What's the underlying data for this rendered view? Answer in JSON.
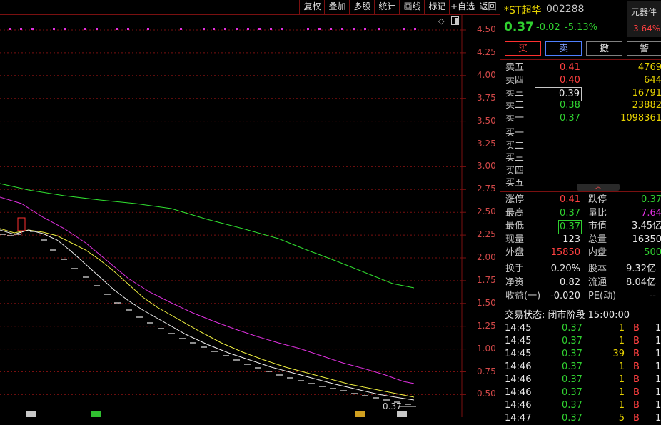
{
  "toolbar": {
    "items": [
      "复权",
      "叠加",
      "多股",
      "统计",
      "画线",
      "标记",
      "+自选",
      "返回"
    ]
  },
  "chart": {
    "y_ticks": [
      "4.50",
      "4.25",
      "4.00",
      "3.75",
      "3.50",
      "3.25",
      "3.00",
      "2.75",
      "2.50",
      "2.25",
      "2.00",
      "1.75",
      "1.50",
      "1.25",
      "1.00",
      "0.75",
      "0.50"
    ],
    "last_price_label": "0.37",
    "colors": {
      "grid": "#7a1010",
      "ma_green": "#30e030",
      "ma_magenta": "#e030e0",
      "ma_yellow": "#f0f040",
      "ma_white": "#f0f0f0",
      "axis_text": "#d04848"
    }
  },
  "quote": {
    "name": "*ST超华",
    "code": "002288",
    "price": "0.37",
    "change": "-0.02",
    "change_pct": "-5.13%",
    "sector": "元器件",
    "sector_pct": "3.64%",
    "buttons": [
      "买",
      "卖",
      "撤",
      "警"
    ],
    "asks": [
      {
        "label": "卖五",
        "price": "0.41",
        "vol": "4769"
      },
      {
        "label": "卖四",
        "price": "0.40",
        "vol": "644"
      },
      {
        "label": "卖三",
        "price": "0.39",
        "vol": "16791"
      },
      {
        "label": "卖二",
        "price": "0.38",
        "vol": "23882"
      },
      {
        "label": "卖一",
        "price": "0.37",
        "vol": "1098361"
      }
    ],
    "bids": [
      "买一",
      "买二",
      "买三",
      "买四",
      "买五"
    ],
    "stats": [
      {
        "l1": "涨停",
        "v1": "0.41",
        "l2": "跌停",
        "v2": "0.37"
      },
      {
        "l1": "最高",
        "v1": "0.37",
        "l2": "量比",
        "v2": "7.64"
      },
      {
        "l1": "最低",
        "v1": "0.37",
        "l2": "市值",
        "v2": "3.45亿"
      },
      {
        "l1": "现量",
        "v1": "123",
        "l2": "总量",
        "v2": "16350"
      },
      {
        "l1": "外盘",
        "v1": "15850",
        "l2": "内盘",
        "v2": "500"
      }
    ],
    "stats2": [
      {
        "l1": "换手",
        "v1": "0.20%",
        "l2": "股本",
        "v2": "9.32亿"
      },
      {
        "l1": "净资",
        "v1": "0.82",
        "l2": "流通",
        "v2": "8.04亿"
      },
      {
        "l1": "收益(一)",
        "v1": "-0.020",
        "l2": "PE(动)",
        "v2": "--"
      }
    ],
    "status_label": "交易状态: 闭市阶段 15:00:00",
    "ticks": [
      {
        "time": "14:45",
        "price": "0.37",
        "vol": "1",
        "side": "B",
        "n": "1"
      },
      {
        "time": "14:45",
        "price": "0.37",
        "vol": "1",
        "side": "B",
        "n": "1"
      },
      {
        "time": "14:45",
        "price": "0.37",
        "vol": "39",
        "side": "B",
        "n": "1"
      },
      {
        "time": "14:46",
        "price": "0.37",
        "vol": "1",
        "side": "B",
        "n": "1"
      },
      {
        "time": "14:46",
        "price": "0.37",
        "vol": "1",
        "side": "B",
        "n": "1"
      },
      {
        "time": "14:46",
        "price": "0.37",
        "vol": "1",
        "side": "B",
        "n": "1"
      },
      {
        "time": "14:46",
        "price": "0.37",
        "vol": "1",
        "side": "B",
        "n": "1"
      },
      {
        "time": "14:47",
        "price": "0.37",
        "vol": "5",
        "side": "B",
        "n": "1"
      }
    ]
  }
}
